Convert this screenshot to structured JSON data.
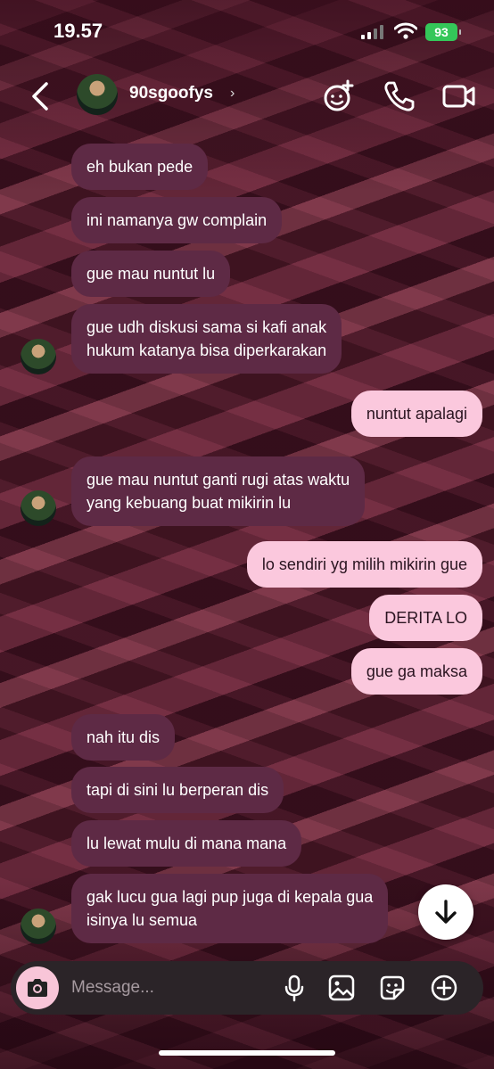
{
  "status": {
    "time": "19.57",
    "battery": "93"
  },
  "header": {
    "username": "90sgoofys"
  },
  "messages": [
    {
      "dir": "in",
      "text": "eh bukan pede"
    },
    {
      "dir": "in",
      "text": "ini namanya gw complain"
    },
    {
      "dir": "in",
      "text": "gue mau nuntut lu"
    },
    {
      "dir": "in",
      "line1": "gue udh diskusi sama si kafi anak",
      "line2": "hukum katanya bisa diperkarakan"
    },
    {
      "dir": "out",
      "text": "nuntut apalagi"
    },
    {
      "dir": "in",
      "line1": "gue mau nuntut ganti rugi atas waktu",
      "line2": "yang kebuang buat mikirin lu"
    },
    {
      "dir": "out",
      "text": "lo sendiri yg milih mikirin gue"
    },
    {
      "dir": "out",
      "text": "DERITA LO"
    },
    {
      "dir": "out",
      "text": "gue ga maksa"
    },
    {
      "dir": "in",
      "text": "nah itu dis"
    },
    {
      "dir": "in",
      "text": "tapi di sini lu berperan dis"
    },
    {
      "dir": "in",
      "text": "lu lewat mulu di mana mana"
    },
    {
      "dir": "in",
      "line1": "gak lucu gua lagi pup juga di kepala gua",
      "line2": "isinya lu semua"
    }
  ],
  "composer": {
    "placeholder": "Message..."
  }
}
